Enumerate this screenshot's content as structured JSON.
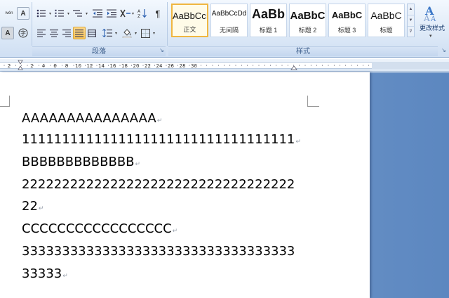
{
  "ribbon": {
    "groups": {
      "paragraph": "段落",
      "styles": "样式"
    },
    "styles_gallery": [
      {
        "sample": "AaBbCcI",
        "name": "正文",
        "selected": true
      },
      {
        "sample": "AaBbCcDd",
        "name": "无间隔",
        "selected": false
      },
      {
        "sample": "AaBb",
        "name": "标题 1",
        "selected": false
      },
      {
        "sample": "AaBbC",
        "name": "标题 2",
        "selected": false
      },
      {
        "sample": "AaBbC",
        "name": "标题 3",
        "selected": false
      },
      {
        "sample": "AaBbC",
        "name": "标题",
        "selected": false
      }
    ],
    "change_styles_label": "更改样式",
    "left_icons": {
      "char_border": "A",
      "enclose": "字",
      "phonetic": "wén"
    }
  },
  "ruler": {
    "numbers": [
      "2",
      "2",
      "4",
      "6",
      "8",
      "10",
      "12",
      "14",
      "16",
      "18",
      "20",
      "22",
      "24",
      "26",
      "28",
      "30"
    ]
  },
  "document": {
    "lines": [
      "AAAAAAAAAAAAAAA",
      "1111111111111111111111111111111111",
      "BBBBBBBBBBBBB",
      "2222222222222222222222222222222222",
      "22",
      "CCCCCCCCCCCCCCCCC",
      "3333333333333333333333333333333333",
      "33333"
    ],
    "paragraph_marks": [
      true,
      true,
      true,
      false,
      true,
      true,
      false,
      true
    ],
    "pilcrow": "↵"
  },
  "colors": {
    "ribbon_top": "#f3f8fe",
    "ribbon_bottom": "#cfdff3",
    "workspace": "#6b93c7",
    "selected_style_border": "#f0b640",
    "highlight_button": "#f8c45a"
  }
}
